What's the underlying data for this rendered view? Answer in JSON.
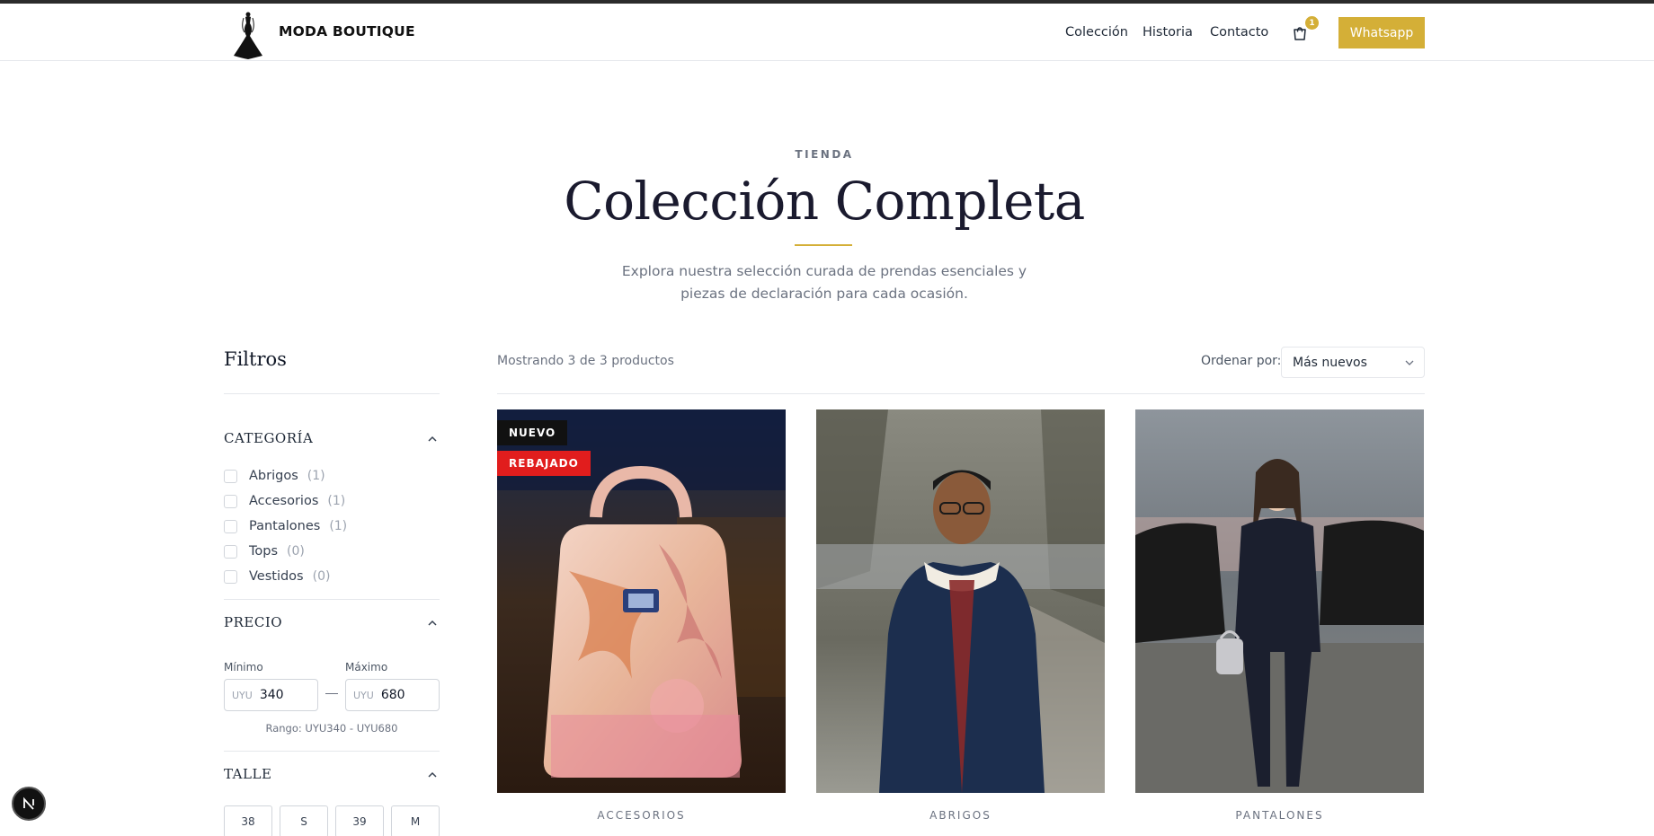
{
  "header": {
    "brand": "MODA BOUTIQUE",
    "nav": [
      "Colección",
      "Historia",
      "Contacto"
    ],
    "cart_count": "1",
    "cta_label": "Whatsapp",
    "logo_icon": "dress-logo-icon",
    "cart_icon": "shopping-bag-icon"
  },
  "hero": {
    "eyebrow": "TIENDA",
    "title": "Colección Completa",
    "subtitle": "Explora nuestra selección curada de prendas esenciales y piezas de declaración para cada ocasión."
  },
  "filters": {
    "title": "Filtros",
    "category": {
      "title": "CATEGORÍA",
      "items": [
        {
          "label": "Abrigos",
          "count": "(1)"
        },
        {
          "label": "Accesorios",
          "count": "(1)"
        },
        {
          "label": "Pantalones",
          "count": "(1)"
        },
        {
          "label": "Tops",
          "count": "(0)"
        },
        {
          "label": "Vestidos",
          "count": "(0)"
        }
      ]
    },
    "price": {
      "title": "PRECIO",
      "min_label": "Mínimo",
      "max_label": "Máximo",
      "currency": "UYU",
      "min_value": "340",
      "max_value": "680",
      "range_note": "Rango: UYU340 - UYU680"
    },
    "size": {
      "title": "TALLE",
      "options": [
        "38",
        "S",
        "39",
        "M"
      ]
    }
  },
  "products": {
    "showing": "Mostrando 3 de 3 productos",
    "sort_label": "Ordenar por:",
    "sort_value": "Más nuevos",
    "items": [
      {
        "category": "ACCESORIOS",
        "badges": [
          "NUEVO",
          "REBAJADO"
        ]
      },
      {
        "category": "ABRIGOS",
        "badges": []
      },
      {
        "category": "PANTALONES",
        "badges": []
      }
    ]
  },
  "colors": {
    "accent": "#d4af37",
    "sale": "#e11d1d",
    "dark": "#111111"
  },
  "fab_label": "N"
}
